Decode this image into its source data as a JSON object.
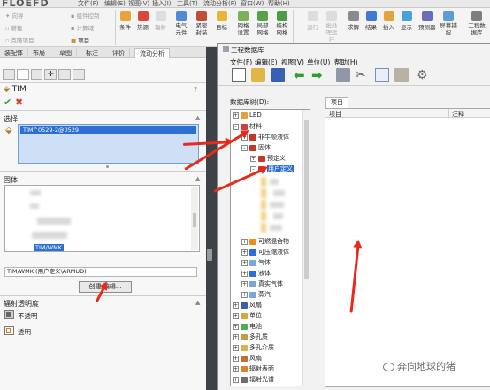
{
  "app": {
    "logo": "FLOEFD",
    "menu": [
      "文件(F)",
      "编辑(E)",
      "视图(V)",
      "插入(I)",
      "工具(T)",
      "流动分析(F)",
      "窗口(W)",
      "帮助(H)"
    ]
  },
  "ribbon": {
    "left_small": [
      {
        "label": "向导",
        "icon": "wand-icon"
      },
      {
        "label": "新建",
        "icon": "new-icon"
      },
      {
        "label": "克隆项目",
        "icon": "clone-icon"
      }
    ],
    "mid_small": [
      {
        "label": "组件控制"
      },
      {
        "label": "计算域"
      },
      {
        "label": "项目"
      }
    ],
    "buttons": [
      {
        "label": "条件"
      },
      {
        "label": "热源"
      },
      {
        "label": "辐射"
      },
      {
        "label": "电气元件"
      },
      {
        "label": "紧密封装"
      },
      {
        "label": "目标"
      },
      {
        "label": "网格设置"
      },
      {
        "label": "局部网格"
      },
      {
        "label": "结构网格"
      }
    ],
    "buttons_right": [
      {
        "label": "运行"
      },
      {
        "label": "批处理运行"
      },
      {
        "label": "求解"
      },
      {
        "label": "结果"
      },
      {
        "label": "插入"
      },
      {
        "label": "显示"
      },
      {
        "label": "预测器"
      },
      {
        "label": "屏幕捕捉"
      },
      {
        "label": "工程数据库"
      }
    ]
  },
  "left_tabs": [
    "装配体",
    "布局",
    "草图",
    "标注",
    "评价",
    "流动分析"
  ],
  "panel": {
    "title": "TIM",
    "help": "?",
    "selection_section": "选择",
    "selection_item": "TIM^0529-2@0529",
    "solid_section": "固体",
    "solid_selected": "TIM/WMK",
    "solid_path": "TIM/WMK (用户定义\\ARMUD)",
    "create_edit_button": "创建/编辑...",
    "radiation_section": "辐射透明度",
    "opaque": "不透明",
    "transparent": "透明"
  },
  "db_window": {
    "title": "工程数据库",
    "menu": [
      "文件(F)",
      "编辑(E)",
      "视图(V)",
      "单位(U)",
      "帮助(H)"
    ],
    "tree_label": "数据库树(D):",
    "tab_items": "项目",
    "col_item": "项目",
    "col_note": "注释",
    "tree": [
      {
        "label": "LED",
        "level": 1,
        "exp": "+",
        "color": "#e2a23a"
      },
      {
        "label": "材料",
        "level": 1,
        "exp": "-",
        "color": "#d43a3a"
      },
      {
        "label": "非牛顿液体",
        "level": 2,
        "exp": "+",
        "color": "#c0392b"
      },
      {
        "label": "固体",
        "level": 2,
        "exp": "-",
        "color": "#c0392b"
      },
      {
        "label": "预定义",
        "level": 3,
        "exp": "+",
        "color": "#c0392b"
      },
      {
        "label": "用户定义",
        "level": 3,
        "exp": "-",
        "color": "#c0392b",
        "selected": true
      },
      {
        "label": "可燃混合物",
        "level": 2,
        "exp": "+",
        "color": "#f08c1a"
      },
      {
        "label": "可压缩液体",
        "level": 2,
        "exp": "+",
        "color": "#2b6fd6"
      },
      {
        "label": "气体",
        "level": 2,
        "exp": "+",
        "color": "#7aa7d8"
      },
      {
        "label": "液体",
        "level": 2,
        "exp": "+",
        "color": "#2b6fd6"
      },
      {
        "label": "真实气体",
        "level": 2,
        "exp": "+",
        "color": "#7aa7d8"
      },
      {
        "label": "蒸汽",
        "level": 2,
        "exp": "+",
        "color": "#7aa7d8"
      },
      {
        "label": "风扇",
        "level": 1,
        "exp": "+",
        "color": "#3b5fa8"
      },
      {
        "label": "单位",
        "level": 1,
        "exp": "+",
        "color": "#d8a93a"
      },
      {
        "label": "电池",
        "level": 1,
        "exp": "+",
        "color": "#4caf50"
      },
      {
        "label": "多孔质",
        "level": 1,
        "exp": "+",
        "color": "#c59b3e"
      },
      {
        "label": "多孔介质",
        "level": 1,
        "exp": "+",
        "color": "#d7b34e"
      },
      {
        "label": "风扇",
        "level": 1,
        "exp": "+",
        "color": "#c07030"
      },
      {
        "label": "辐射表面",
        "level": 1,
        "exp": "+",
        "color": "#e0802a"
      },
      {
        "label": "辐射光谱",
        "level": 1,
        "exp": "+",
        "color": "#6d6d6d"
      }
    ]
  },
  "watermark": "奔向地球的猪",
  "colors": {
    "arrow": "#e8291c",
    "selection": "#2e6fd3",
    "panel_bg": "#f7f7f7",
    "window_bg": "#f2f2f2"
  }
}
